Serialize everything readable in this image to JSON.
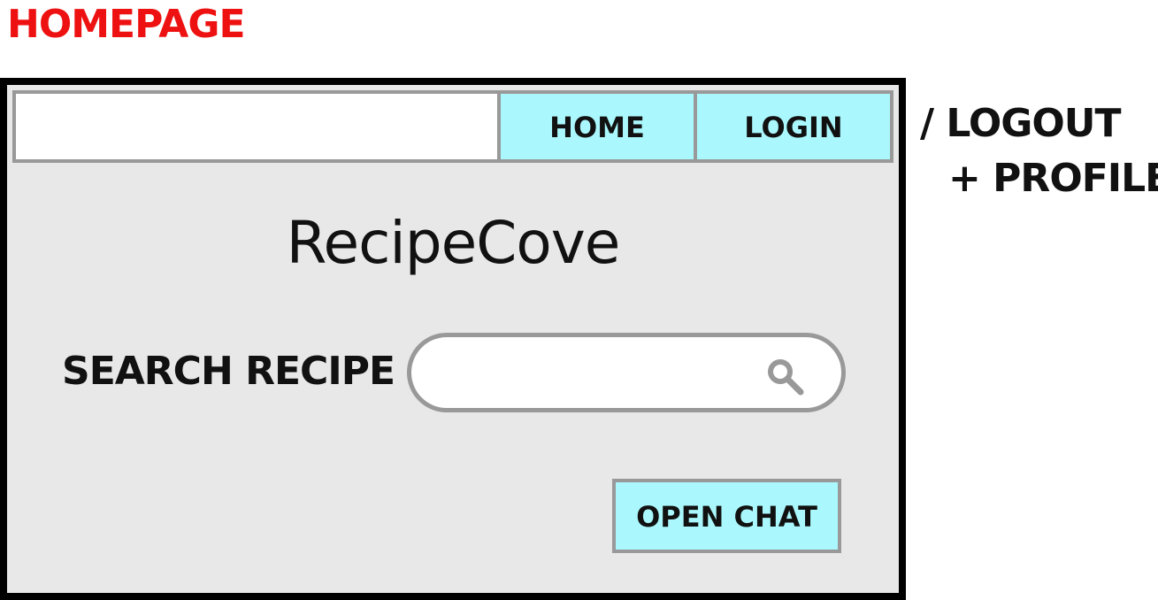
{
  "page_label": "HOMEPAGE",
  "nav": {
    "home_label": "HOME",
    "login_label": "LOGIN"
  },
  "side_notes": {
    "logout": "/ LOGOUT",
    "profile": "+ PROFILE"
  },
  "main": {
    "title": "RecipeCove",
    "search_label": "SEARCH RECIPE",
    "search_value": "",
    "search_icon": "search-icon",
    "chat_button_label": "OPEN CHAT"
  },
  "colors": {
    "page_label": "#ee1111",
    "button_fill": "#aaf8fd",
    "frame_fill": "#e8e8e8",
    "border_gray": "#999999",
    "frame_border": "#000000"
  }
}
